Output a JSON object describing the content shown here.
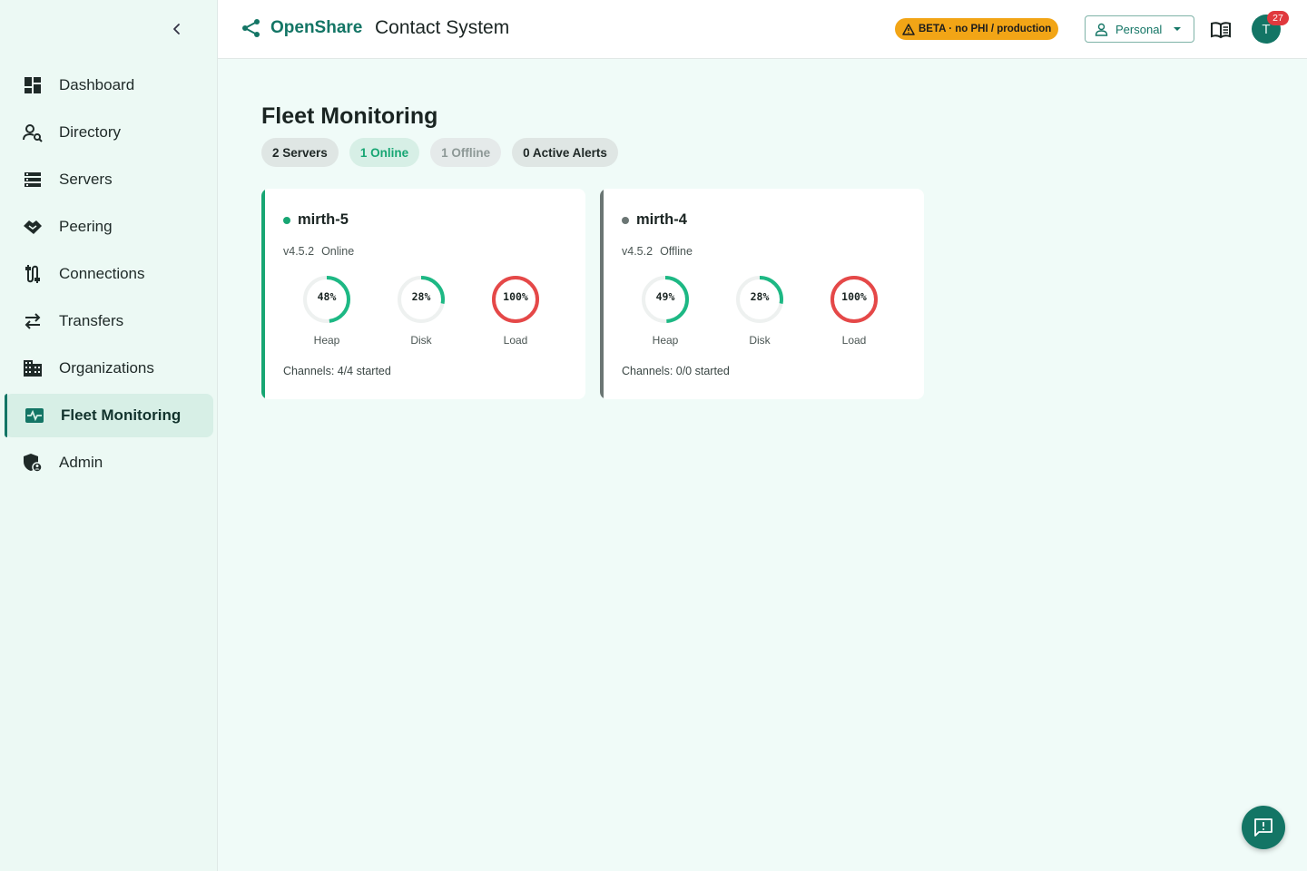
{
  "brand": {
    "name": "OpenShare",
    "icon": "share-icon"
  },
  "header": {
    "app_title": "Contact System",
    "beta_badge": "BETA · no PHI / production",
    "workspace": "Personal",
    "avatar_initial": "T",
    "notification_count": "27"
  },
  "sidebar": {
    "items": [
      {
        "label": "Dashboard",
        "icon": "dashboard-icon"
      },
      {
        "label": "Directory",
        "icon": "person-search-icon"
      },
      {
        "label": "Servers",
        "icon": "server-list-icon"
      },
      {
        "label": "Peering",
        "icon": "handshake-icon"
      },
      {
        "label": "Connections",
        "icon": "connections-icon"
      },
      {
        "label": "Transfers",
        "icon": "transfer-arrows-icon"
      },
      {
        "label": "Organizations",
        "icon": "building-icon"
      },
      {
        "label": "Fleet Monitoring",
        "icon": "monitor-heartbeat-icon",
        "active": true
      },
      {
        "label": "Admin",
        "icon": "admin-shield-icon"
      }
    ]
  },
  "main": {
    "title": "Fleet Monitoring",
    "chips": {
      "servers": "2 Servers",
      "online": "1 Online",
      "offline": "1 Offline",
      "alerts": "0 Active Alerts"
    },
    "servers": [
      {
        "name": "mirth-5",
        "version": "v4.5.2",
        "status": "Online",
        "status_color": "#17a673",
        "gauges": [
          {
            "label": "Heap",
            "value": 48,
            "text": "48%",
            "color": "#1db884"
          },
          {
            "label": "Disk",
            "value": 28,
            "text": "28%",
            "color": "#1db884"
          },
          {
            "label": "Load",
            "value": 100,
            "text": "100%",
            "color": "#e54848"
          }
        ],
        "channels": "Channels: 4/4 started"
      },
      {
        "name": "mirth-4",
        "version": "v4.5.2",
        "status": "Offline",
        "status_color": "#6b7674",
        "gauges": [
          {
            "label": "Heap",
            "value": 49,
            "text": "49%",
            "color": "#1db884"
          },
          {
            "label": "Disk",
            "value": 28,
            "text": "28%",
            "color": "#1db884"
          },
          {
            "label": "Load",
            "value": 100,
            "text": "100%",
            "color": "#e54848"
          }
        ],
        "channels": "Channels: 0/0 started"
      }
    ]
  },
  "colors": {
    "accent": "#137565",
    "warning": "#f2a516",
    "danger": "#e54848",
    "ok": "#1db884"
  }
}
